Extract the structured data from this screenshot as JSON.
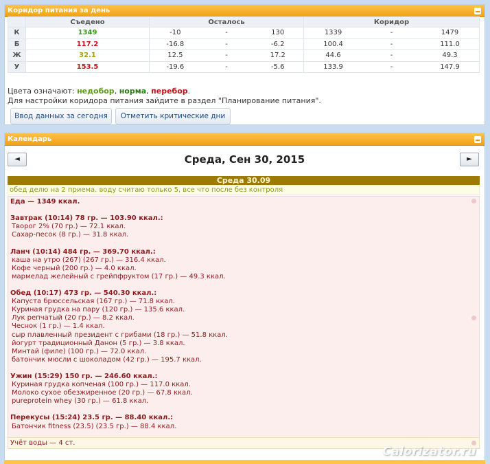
{
  "corridor": {
    "title": "Коридор питания за день",
    "headers": {
      "eaten": "Съедено",
      "left": "Осталось",
      "corridor": "Коридор"
    },
    "rows": [
      {
        "label": "К",
        "eaten": "1349",
        "left_min": "-10",
        "left_sep": "-",
        "left_max": "130",
        "cor_min": "1339",
        "cor_sep": "-",
        "cor_max": "1479",
        "status_color": "#3b9a1f"
      },
      {
        "label": "Б",
        "eaten": "117.2",
        "left_min": "-16.8",
        "left_sep": "-",
        "left_max": "-6.2",
        "cor_min": "100.4",
        "cor_sep": "-",
        "cor_max": "111.0",
        "status_color": "#c2131a"
      },
      {
        "label": "Ж",
        "eaten": "32.1",
        "left_min": "12.5",
        "left_sep": "-",
        "left_max": "17.2",
        "cor_min": "44.6",
        "cor_sep": "-",
        "cor_max": "49.3",
        "status_color": "#a0a012"
      },
      {
        "label": "У",
        "eaten": "153.5",
        "left_min": "-19.6",
        "left_sep": "-",
        "left_max": "-5.6",
        "cor_min": "133.9",
        "cor_sep": "-",
        "cor_max": "147.9",
        "status_color": "#c2131a"
      }
    ],
    "legend_prefix": "Цвета означают: ",
    "legend_under": "недобор",
    "legend_sep1": ", ",
    "legend_norm": "норма",
    "legend_sep2": ", ",
    "legend_over": "перебор",
    "legend_end": ".",
    "settings_note": "Для настройки коридора питания зайдите в раздел \"Планирование питания\".",
    "btn_enter": "Ввод данных за сегодня",
    "btn_critical": "Отметить критические дни"
  },
  "calendar": {
    "title": "Календарь",
    "prev_label": "◄",
    "next_label": "►",
    "date_title": "Среда, Сен 30, 2015",
    "day_bar": "Среда 30.09",
    "note": "обед делю на 2 приема. воду считаю только 5, все что после без контроля",
    "diary": [
      {
        "type": "meal",
        "text": "Еда — 1349 ккал."
      },
      {
        "type": "spacer",
        "text": ""
      },
      {
        "type": "meal",
        "text": "Завтрак (10:14) 78 гр. — 103.90 ккал.:"
      },
      {
        "type": "item",
        "text": "Творог 2% (70 гр.) — 72.1 ккал."
      },
      {
        "type": "item",
        "text": "Сахар-песок (8 гр.) — 31.8 ккал."
      },
      {
        "type": "spacer",
        "text": ""
      },
      {
        "type": "meal",
        "text": "Ланч (10:14) 484 гр. — 369.70 ккал.:"
      },
      {
        "type": "item",
        "text": "каша на утро (267) (267 гр.) — 316.4 ккал."
      },
      {
        "type": "item",
        "text": "Кофе черный (200 гр.) — 4.0 ккал."
      },
      {
        "type": "item",
        "text": "мармелад желейный с грейпфруктом (17 гр.) — 49.3 ккал."
      },
      {
        "type": "spacer",
        "text": ""
      },
      {
        "type": "meal",
        "text": "Обед (10:17) 473 гр. — 540.30 ккал.:"
      },
      {
        "type": "item",
        "text": "Капуста брюссельская (167 гр.) — 71.8 ккал."
      },
      {
        "type": "item",
        "text": "Куриная грудка на пару (120 гр.) — 135.6 ккал."
      },
      {
        "type": "item",
        "text": "Лук репчатый (20 гр.) — 8.2 ккал."
      },
      {
        "type": "item",
        "text": "Чеснок (1 гр.) — 1.4 ккал."
      },
      {
        "type": "item",
        "text": "сыр плавленный президент с грибами (18 гр.) — 51.8 ккал."
      },
      {
        "type": "item",
        "text": "йогурт традиционный Данон (5 гр.) — 3.8 ккал."
      },
      {
        "type": "item",
        "text": "Минтай (филе) (100 гр.) — 72.0 ккал."
      },
      {
        "type": "item",
        "text": "батончик мюсли с шоколадом (42 гр.) — 195.7 ккал."
      },
      {
        "type": "spacer",
        "text": ""
      },
      {
        "type": "meal",
        "text": "Ужин (15:29) 150 гр. — 246.60 ккал.:"
      },
      {
        "type": "item",
        "text": "Куриная грудка копченая (100 гр.) — 117.0 ккал."
      },
      {
        "type": "item",
        "text": "Молоко сухое обезжиренное (20 гр.) — 67.8 ккал."
      },
      {
        "type": "item",
        "text": "pureprotein whey (30 гр.) — 61.8 ккал."
      },
      {
        "type": "spacer",
        "text": ""
      },
      {
        "type": "meal",
        "text": "Перекусы (15:24) 23.5 гр. — 88.40 ккал.:"
      },
      {
        "type": "item",
        "text": "Батончик fitness (23.5) (23.5 гр.) — 88.4 ккал."
      }
    ],
    "water": "Учёт воды — 4 ст."
  },
  "watermark": "Calorizator.ru"
}
